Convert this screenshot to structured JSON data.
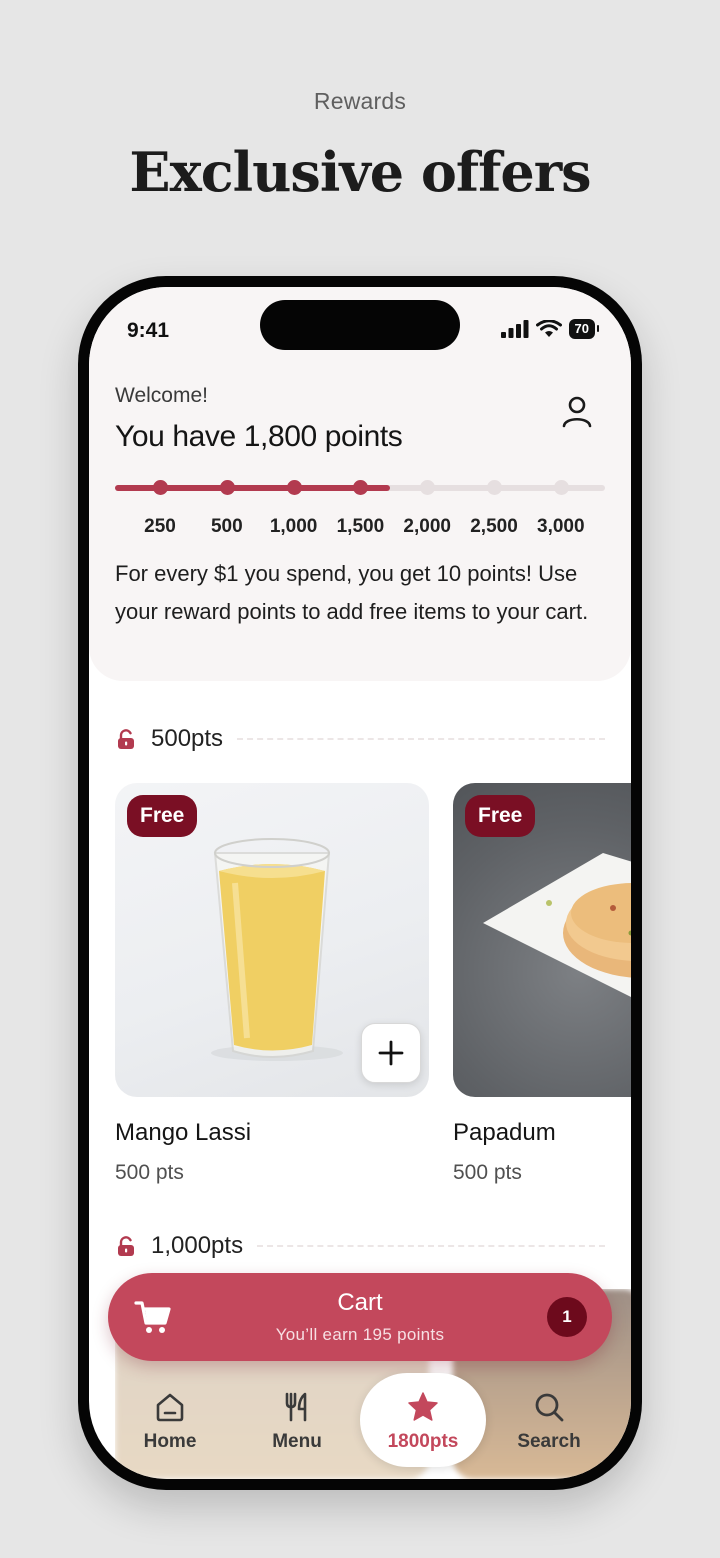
{
  "page": {
    "eyebrow": "Rewards",
    "headline": "Exclusive offers"
  },
  "status_bar": {
    "time": "9:41",
    "battery": "70"
  },
  "rewards": {
    "welcome": "Welcome!",
    "points_title": "You have 1,800 points",
    "current_points": 1800,
    "tiers": [
      "250",
      "500",
      "1,000",
      "1,500",
      "2,000",
      "2,500",
      "3,000"
    ],
    "reached_tier_count": 4,
    "explanation": "For every $1 you spend, you get 10 points! Use your reward points to add free items to your cart."
  },
  "sections": [
    {
      "label": "500pts",
      "items": [
        {
          "name": "Mango Lassi",
          "points": "500 pts",
          "badge": "Free",
          "icon": "mango-lassi-glass"
        },
        {
          "name": "Papadum",
          "points": "500 pts",
          "badge": "Free",
          "icon": "papadum-plate"
        }
      ]
    },
    {
      "label": "1,000pts",
      "items": []
    }
  ],
  "cart": {
    "title": "Cart",
    "subtitle": "You’ll earn 195 points",
    "count": "1"
  },
  "tabs": [
    {
      "label": "Home",
      "icon": "home-icon"
    },
    {
      "label": "Menu",
      "icon": "utensils-icon"
    },
    {
      "label": "1800pts",
      "icon": "star-icon",
      "active": true
    },
    {
      "label": "Search",
      "icon": "search-icon"
    }
  ],
  "colors": {
    "accent": "#b23a4f",
    "cart": "#c3485c",
    "badge": "#7a0f24",
    "track": "#e6dfe0",
    "hero_bg": "#f8f5f5",
    "page_bg": "#e6e6e6"
  }
}
